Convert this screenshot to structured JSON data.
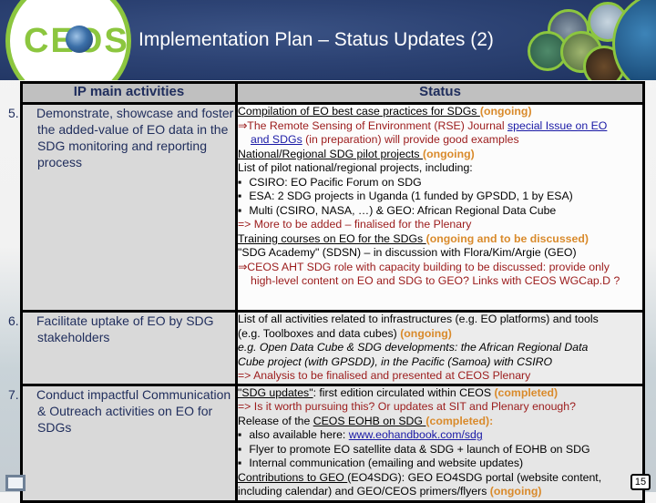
{
  "header": {
    "logo_text": "CEOS",
    "title": "Implementation Plan – Status Updates (2)"
  },
  "table": {
    "headers": [
      "IP main activities",
      "Status"
    ],
    "rows": [
      {
        "num": "5.",
        "activity": "Demonstrate, showcase and foster the added-value of EO data in the SDG monitoring and reporting process",
        "status": {
          "l1_u": "Compilation of EO best case practices for SDGs ",
          "l1_s": "(ongoing)",
          "l2_a": "⇒The Remote Sensing of Environment (RSE) Journal ",
          "l2_link": "special Issue on EO",
          "l3_link": "and SDGs",
          "l3_b": " (in preparation) will provide good examples",
          "l4_u": "National/Regional SDG pilot projects ",
          "l4_s": "(ongoing)",
          "l5": "List of pilot national/regional projects, including:",
          "bullets": [
            "CSIRO: EO Pacific Forum on SDG",
            "ESA: 2 SDG projects in Uganda (1 funded by GPSDD, 1 by ESA)",
            "Multi (CSIRO, NASA, …) & GEO: African Regional Data Cube"
          ],
          "l9": "=> More to be added – finalised for the Plenary",
          "l10_u": "Training courses on EO for the SDGs ",
          "l10_s": "(ongoing and to be discussed)",
          "l11": "\"SDG Academy\" (SDSN) – in discussion with Flora/Kim/Argie (GEO)",
          "l12": "⇒CEOS AHT SDG role with capacity building to be discussed: provide only",
          "l13": "high-level content on EO and SDG to GEO? Links with CEOS WGCap.D ?"
        }
      },
      {
        "num": "6.",
        "activity": "Facilitate uptake of EO by SDG stakeholders",
        "status": {
          "l1": "List of all activities related to infrastructures (e.g. EO platforms) and tools",
          "l2_a": "(e.g. Toolboxes and data cubes) ",
          "l2_s": "(ongoing)",
          "l3": "e.g. Open Data Cube & SDG developments: the African Regional Data",
          "l4": "Cube project (with GPSDD), in the Pacific (Samoa) with CSIRO",
          "l5": "=> Analysis to be finalised and presented at CEOS Plenary"
        }
      },
      {
        "num": "7.",
        "activity": "Conduct impactful Communication & Outreach activities on EO for SDGs",
        "status": {
          "l1_u": "\"SDG updates\"",
          "l1_b": ": first edition circulated within CEOS ",
          "l1_s": "(completed)",
          "l2": "=> Is it worth pursuing this? Or updates at SIT and Plenary enough?",
          "l3_a": "Release of the ",
          "l3_u": "CEOS EOHB on SDG ",
          "l3_s": "(completed)",
          "l3_c": ":",
          "b1_a": "also available here: ",
          "b1_link": "www.eohandbook.com/sdg",
          "b2": "Flyer to promote EO satellite data & SDG + launch of EOHB on SDG",
          "b3": "Internal communication (emailing and website updates)",
          "l7_u": "Contributions to GEO ",
          "l7_b": "(EO4SDG): GEO EO4SDG portal (website content,",
          "l8_a": "including calendar) and GEO/CEOS primers/flyers  ",
          "l8_s": "(ongoing)"
        }
      }
    ]
  },
  "page_number": "15"
}
